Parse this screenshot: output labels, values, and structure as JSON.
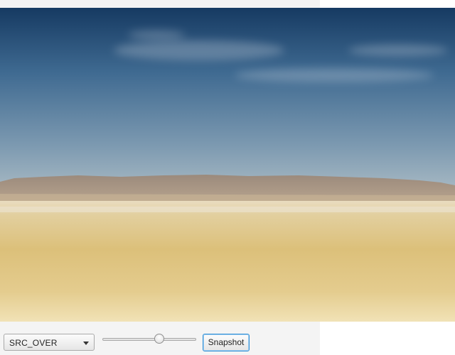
{
  "image": {
    "scene": "desert-mesa-landscape"
  },
  "toolbar": {
    "blend_mode": {
      "selected": "SRC_OVER"
    },
    "opacity_slider": {
      "value_fraction": 0.62
    },
    "snapshot_label": "Snapshot"
  },
  "colors": {
    "sky_top": "#1a3f66",
    "sky_mid": "#4e7598",
    "sky_horizon": "#9fb3c1",
    "mesa": "#a79684",
    "sand_light": "#ebdcaf",
    "sand": "#e1c57f",
    "focus_blue": "#2f8fd6"
  }
}
